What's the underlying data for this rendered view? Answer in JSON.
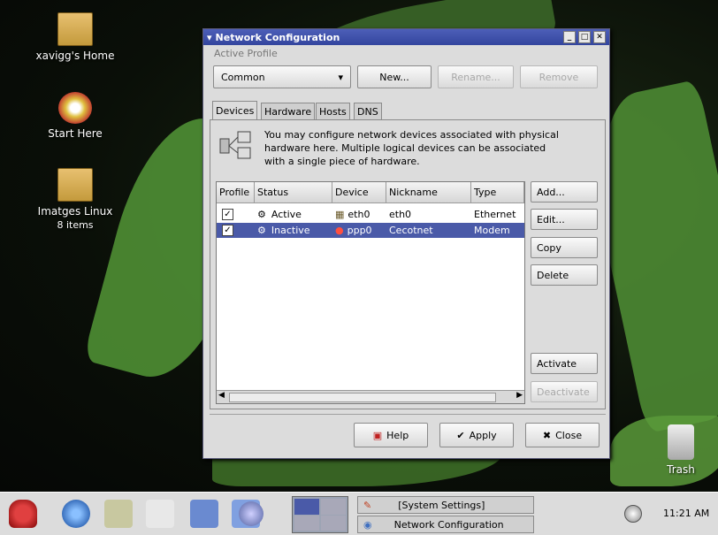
{
  "desktop": {
    "icons": [
      {
        "label": "xavigg's Home"
      },
      {
        "label": "Start Here"
      },
      {
        "label": "Imatges Linux",
        "sublabel": "8 items"
      },
      {
        "label": "Trash"
      }
    ]
  },
  "window": {
    "title": "Network Configuration",
    "active_profile_label": "Active Profile",
    "profile_value": "Common",
    "buttons": {
      "new": "New...",
      "rename": "Rename...",
      "remove": "Remove"
    },
    "tabs": [
      "Devices",
      "Hardware",
      "Hosts",
      "DNS"
    ],
    "description": "You may configure network devices associated with physical hardware here.  Multiple logical devices can be associated with a single piece of hardware.",
    "columns": [
      "Profile",
      "Status",
      "Device",
      "Nickname",
      "Type"
    ],
    "rows": [
      {
        "profile": "✓",
        "status": "Active",
        "device": "eth0",
        "nickname": "eth0",
        "type": "Ethernet"
      },
      {
        "profile": "✓",
        "status": "Inactive",
        "device": "ppp0",
        "nickname": "Cecotnet",
        "type": "Modem"
      }
    ],
    "side_buttons": {
      "add": "Add...",
      "edit": "Edit...",
      "copy": "Copy",
      "delete": "Delete",
      "activate": "Activate",
      "deactivate": "Deactivate"
    },
    "bottom_buttons": {
      "help": "Help",
      "apply": "Apply",
      "close": "Close"
    }
  },
  "taskbar": {
    "tasks": [
      "[System Settings]",
      "Network Configuration"
    ],
    "clock": "11:21 AM"
  },
  "colors": {
    "titlebar": "#3a4ca8",
    "selection": "#4a5aa8"
  }
}
